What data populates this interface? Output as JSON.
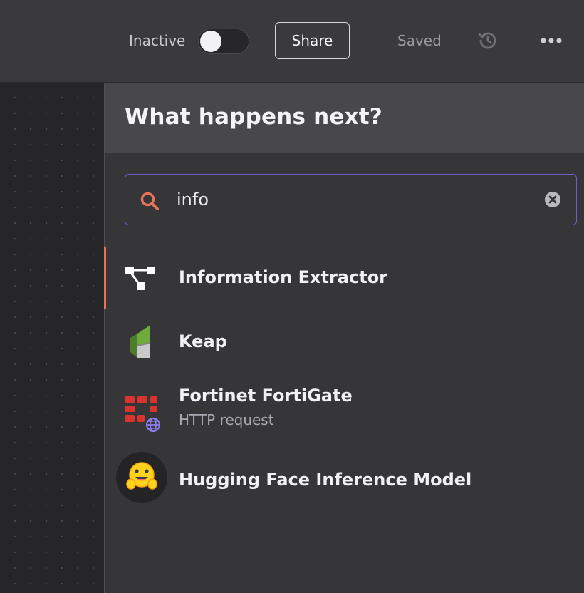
{
  "topbar": {
    "active_label": "Inactive",
    "share_label": "Share",
    "saved_label": "Saved",
    "toggle_on": false
  },
  "panel": {
    "title": "What happens next?",
    "search": {
      "value": "info",
      "placeholder": ""
    },
    "results": [
      {
        "title": "Information Extractor",
        "subtitle": "",
        "icon": "information-extractor-icon",
        "selected": true
      },
      {
        "title": "Keap",
        "subtitle": "",
        "icon": "keap-icon",
        "selected": false
      },
      {
        "title": "Fortinet FortiGate",
        "subtitle": "HTTP request",
        "icon": "fortinet-fortigate-icon",
        "selected": false
      },
      {
        "title": "Hugging Face Inference Model",
        "subtitle": "",
        "icon": "hugging-face-icon",
        "selected": false
      }
    ]
  },
  "colors": {
    "accent_orange": "#e8735a",
    "search_border": "#6a5fc8",
    "fortinet_red": "#d8332f",
    "keap_green": "#6cab3c"
  }
}
